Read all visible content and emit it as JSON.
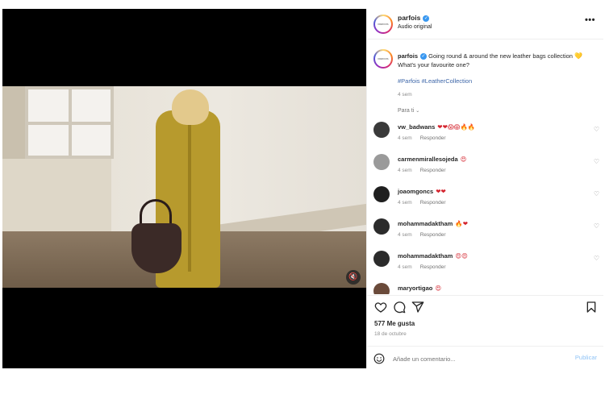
{
  "post": {
    "brand_logo_text": "PARFOIS",
    "username": "parfois",
    "verified": true,
    "audio_label": "Audio original",
    "more_label": "•••"
  },
  "caption": {
    "username": "parfois",
    "text": "Going round & around the new leather bags collection",
    "emoji": "💛",
    "question": "What's your favourite one?",
    "hashtags": [
      "#Parfois",
      "#LeatherCollection"
    ],
    "time": "4 sem",
    "filter_label": "Para ti"
  },
  "comments": [
    {
      "username": "vw_badwans",
      "emojis": "❤❤😱😱🔥🔥",
      "time": "4 sem",
      "reply_label": "Responder",
      "avatar_color": "#3a3a3a"
    },
    {
      "username": "carmenmirallesojeda",
      "emojis": "😍",
      "time": "4 sem",
      "reply_label": "Responder",
      "avatar_color": "#9a9a9a"
    },
    {
      "username": "joaomgoncs",
      "emojis": "❤❤",
      "time": "4 sem",
      "reply_label": "Responder",
      "avatar_color": "#1f1f1f"
    },
    {
      "username": "mohammadaktham",
      "emojis": "🔥❤",
      "time": "4 sem",
      "reply_label": "Responder",
      "avatar_color": "#2b2b2b"
    },
    {
      "username": "mohammadaktham",
      "emojis": "😍😍",
      "time": "4 sem",
      "reply_label": "Responder",
      "avatar_color": "#2b2b2b"
    },
    {
      "username": "maryortigao",
      "emojis": "😍",
      "time": "",
      "reply_label": "",
      "avatar_color": "#6a4a3a"
    }
  ],
  "actions": {
    "likes": "577 Me gusta",
    "date": "18 de octubre",
    "comment_placeholder": "Añade un comentario...",
    "publish_label": "Publicar"
  },
  "colors": {
    "verified": "#3897f0",
    "link": "#3d66a8",
    "publish_disabled": "#8fc3f6",
    "heart_red": "#d4242e"
  }
}
